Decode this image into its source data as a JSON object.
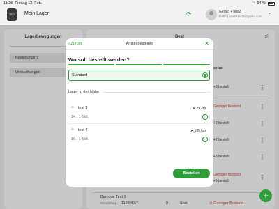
{
  "status_bar": {
    "time": "11:25",
    "date": "Freitag 13. Feb.",
    "battery": "84 %",
    "battery_level": 84
  },
  "app": {
    "title": "Mein Lager",
    "logo_text": "ZEO"
  },
  "user": {
    "name": "Gerald +Test2",
    "email": "testing.pass+test2@gmail.com"
  },
  "sidebar": {
    "title": "Lagerbewegungen",
    "items": [
      {
        "label": "Bestellungen"
      },
      {
        "label": "Umbuchungen"
      }
    ]
  },
  "main": {
    "heading_fragment": "Best",
    "column_header": "weise",
    "statuses": [
      {
        "text": "+3 bestellt",
        "warn": false
      },
      {
        "text": "Geringer Bestand",
        "warn": true
      },
      {
        "text": "+2 bestellt",
        "warn": false
      },
      {
        "text": "+2 bestellt",
        "warn": false
      },
      {
        "text": "+3 bestellt",
        "warn": false
      },
      {
        "text": "Geringer Bestand",
        "warn": true
      },
      {
        "text": "+5 bestellt",
        "warn": false
      }
    ],
    "bottom_row": {
      "title": "Barcode Test 1",
      "code": "11234567",
      "sublabel": "Wendelweg",
      "qty": "0",
      "unit": "Stck",
      "status": "Geringer Bestand"
    }
  },
  "modal": {
    "back_label": "Zurück",
    "title": "Artikel bestellen",
    "question": "Wo soll bestellt werden?",
    "steps": [
      "done",
      "done",
      "done"
    ],
    "selected_option": "Standard",
    "section_title": "Lager in der Nähe",
    "locations": [
      {
        "name": "test 3",
        "distance": "79 km",
        "qty": "14 / 1 Std."
      },
      {
        "name": "test 4",
        "distance": "135 km",
        "qty": "16 / 1 Std."
      }
    ],
    "order_button": "Bestellen"
  },
  "colors": {
    "accent": "#2e9d3a",
    "warning": "#b33333",
    "overlay": "#bdbdbd"
  },
  "icons": [
    "refresh-icon",
    "filter-icon",
    "chevron-left-icon",
    "close-icon",
    "warehouse-icon",
    "navigation-arrow-icon",
    "more-vert-icon",
    "plus-icon",
    "warning-circle-icon"
  ]
}
